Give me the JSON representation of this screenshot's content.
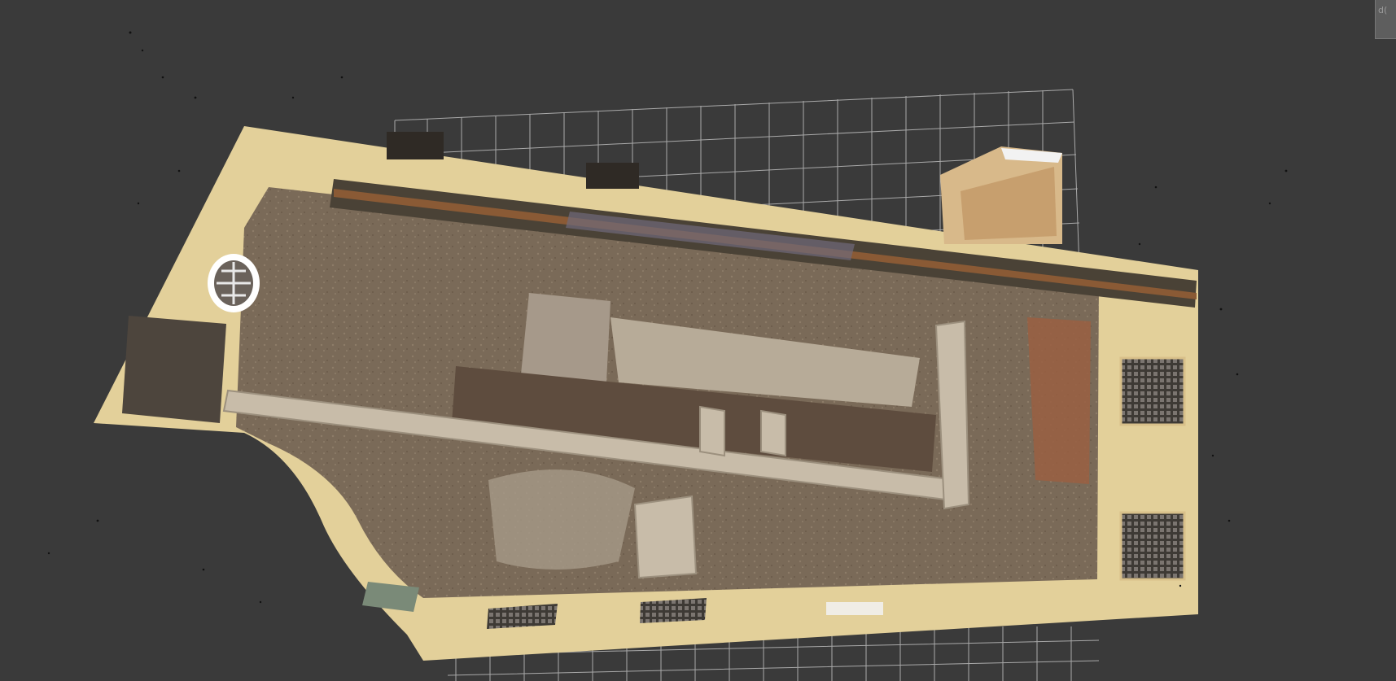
{
  "viewer": {
    "background_color": "#3a3a3a",
    "grid_color": "#bdbdbd",
    "corner_button_label": "d("
  },
  "point_cloud": {
    "wall_color": "#e3d09a",
    "floor_color": "#7a6a58",
    "trench_color": "#5e4c3e",
    "stone_color": "#c8bca9",
    "rust_color": "#8a5a35",
    "rail_color": "#4a4236",
    "grate_color": "#3e3a35",
    "brick_color": "#9a5f42"
  }
}
